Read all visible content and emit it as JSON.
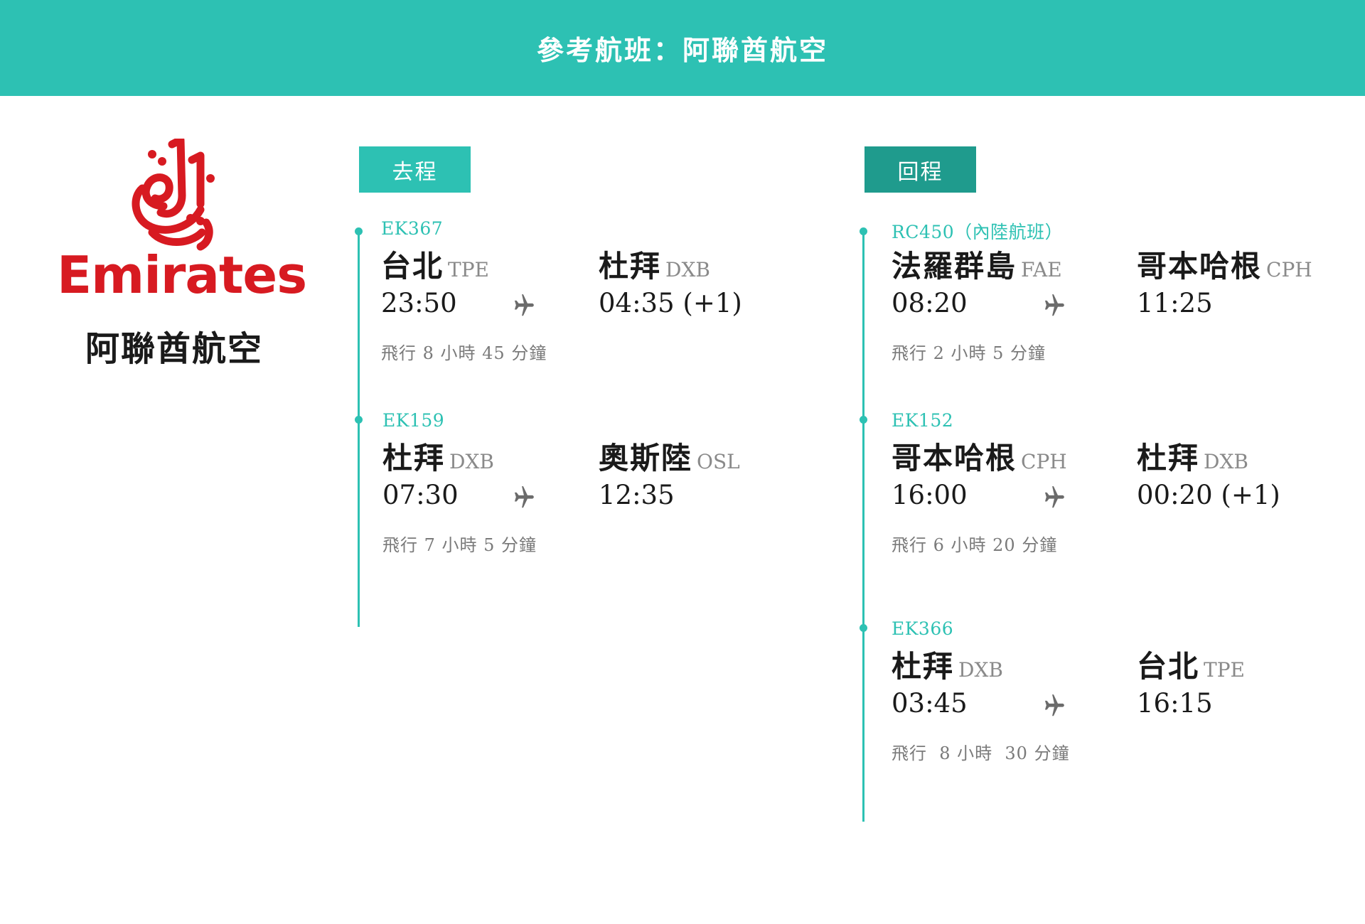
{
  "header": {
    "title": "參考航班：阿聯酋航空"
  },
  "brand": {
    "logo_icon": "emirates-calligraphy-icon",
    "wordmark": "Emirates",
    "name_zh": "阿聯酋航空",
    "color": "#d71a21"
  },
  "colors": {
    "accent": "#2dc1b3",
    "accent_dark": "#1f9b8d"
  },
  "outbound": {
    "label": "去程",
    "segments": [
      {
        "flight": "EK367",
        "from_city": "台北",
        "from_code": "TPE",
        "to_city": "杜拜",
        "to_code": "DXB",
        "depart": "23:50",
        "arrive": "04:35 (+1)",
        "duration": "飛行 8 小時 45 分鐘"
      },
      {
        "flight": "EK159",
        "from_city": "杜拜",
        "from_code": "DXB",
        "to_city": "奧斯陸",
        "to_code": "OSL",
        "depart": "07:30",
        "arrive": "12:35",
        "duration": "飛行 7 小時 5 分鐘"
      }
    ]
  },
  "return": {
    "label": "回程",
    "segments": [
      {
        "flight": "RC450（內陸航班）",
        "from_city": "法羅群島",
        "from_code": "FAE",
        "to_city": "哥本哈根",
        "to_code": "CPH",
        "depart": "08:20",
        "arrive": "11:25",
        "duration": "飛行 2 小時 5 分鐘"
      },
      {
        "flight": "EK152",
        "from_city": "哥本哈根",
        "from_code": "CPH",
        "to_city": "杜拜",
        "to_code": "DXB",
        "depart": "16:00",
        "arrive": "00:20 (+1)",
        "duration": "飛行 6 小時 20 分鐘"
      },
      {
        "flight": "EK366",
        "from_city": "杜拜",
        "from_code": "DXB",
        "to_city": "台北",
        "to_code": "TPE",
        "depart": "03:45",
        "arrive": "16:15",
        "duration": "飛行  8 小時  30 分鐘"
      }
    ]
  }
}
